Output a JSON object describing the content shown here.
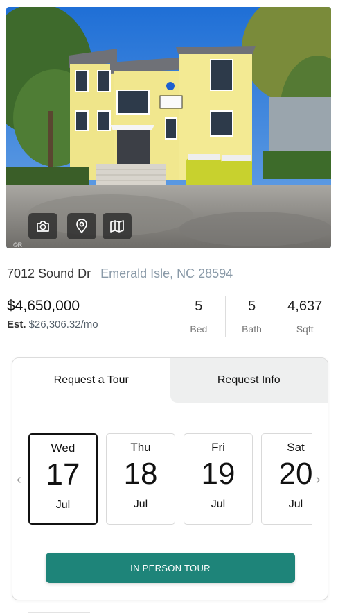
{
  "listing": {
    "photo_credit": "©R",
    "photo_buttons": [
      {
        "icon": "camera-icon"
      },
      {
        "icon": "map-pin-icon"
      },
      {
        "icon": "map-icon"
      }
    ],
    "street": "7012 Sound Dr",
    "city": "Emerald Isle, NC 28594",
    "price": "$4,650,000",
    "est_label": "Est.",
    "est_amount": "$26,306.32/mo",
    "stats": [
      {
        "value": "5",
        "label": "Bed"
      },
      {
        "value": "5",
        "label": "Bath"
      },
      {
        "value": "4,637",
        "label": "Sqft"
      }
    ]
  },
  "tour": {
    "tabs": [
      {
        "label": "Request a Tour",
        "active": true
      },
      {
        "label": "Request Info",
        "active": false
      }
    ],
    "days": [
      {
        "dow": "Wed",
        "day": "17",
        "month": "Jul",
        "selected": true
      },
      {
        "dow": "Thu",
        "day": "18",
        "month": "Jul",
        "selected": false
      },
      {
        "dow": "Fri",
        "day": "19",
        "month": "Jul",
        "selected": false
      },
      {
        "dow": "Sat",
        "day": "20",
        "month": "Jul",
        "selected": false
      }
    ],
    "cta_label": "IN PERSON TOUR"
  },
  "colors": {
    "accent": "#1e8479",
    "city_text": "#8a9aa8",
    "inactive_tab": "#eeefef"
  }
}
